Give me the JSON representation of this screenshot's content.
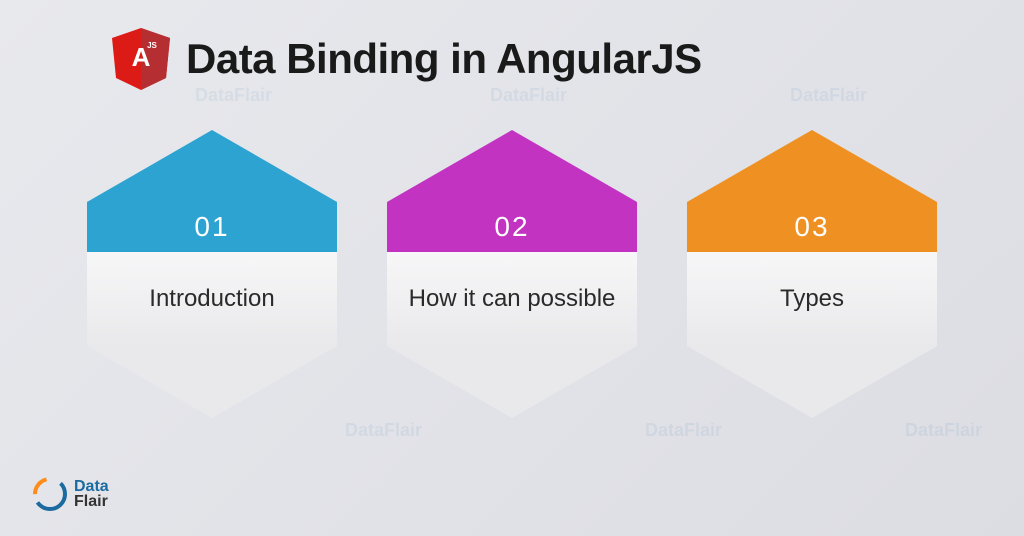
{
  "title": "Data Binding in AngularJS",
  "hexagons": [
    {
      "number": "01",
      "label": "Introduction",
      "color": "#2da3d1"
    },
    {
      "number": "02",
      "label": "How it can possible",
      "color": "#c233c2"
    },
    {
      "number": "03",
      "label": "Types",
      "color": "#ee9022"
    }
  ],
  "logo": {
    "top": "Data",
    "bottom": "Flair"
  },
  "watermark_text": "DataFlair"
}
